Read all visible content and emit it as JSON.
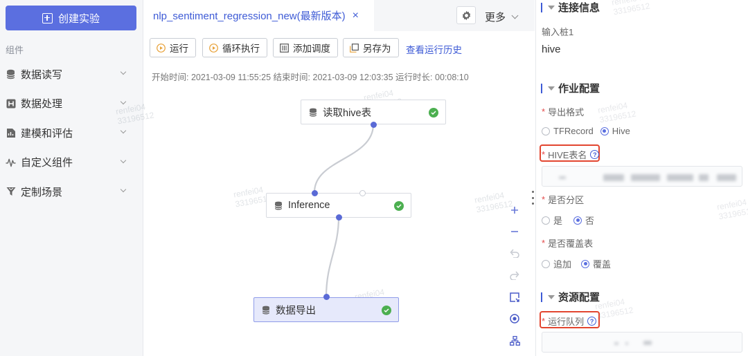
{
  "sidebar": {
    "create_button": "创建实验",
    "group_label": "组件",
    "items": [
      {
        "label": "数据读写",
        "icon": "database-icon"
      },
      {
        "label": "数据处理",
        "icon": "data-processing-icon"
      },
      {
        "label": "建模和评估",
        "icon": "model-icon"
      },
      {
        "label": "自定义组件",
        "icon": "custom-wave-icon"
      },
      {
        "label": "定制场景",
        "icon": "filter-icon"
      }
    ]
  },
  "tab": {
    "title": "nlp_sentiment_regression_new(最新版本)",
    "close": "×"
  },
  "header": {
    "more_label": "更多"
  },
  "toolbar": {
    "run": "运行",
    "loop_run": "循环执行",
    "add_schedule": "添加调度",
    "save_as": "另存为",
    "history_link": "查看运行历史"
  },
  "run_info": "开始时间: 2021-03-09 11:55:25  结束时间: 2021-03-09 12:03:35  运行时长: 00:08:10",
  "nodes": [
    {
      "label": "读取hive表",
      "status": "success"
    },
    {
      "label": "Inference",
      "status": "success"
    },
    {
      "label": "数据导出",
      "status": "success"
    }
  ],
  "watermark": {
    "line1": "renfei04",
    "line2": "33196512"
  },
  "right_panel": {
    "conn_section": "连接信息",
    "input_port_label": "输入桩1",
    "input_port_value": "hive",
    "job_section": "作业配置",
    "export_format_label": "导出格式",
    "export_format_options": [
      "TFRecord",
      "Hive"
    ],
    "export_format_selected": "Hive",
    "hive_table_label": "HIVE表名",
    "partition_label": "是否分区",
    "partition_options": [
      "是",
      "否"
    ],
    "partition_selected": "否",
    "overwrite_label": "是否覆盖表",
    "overwrite_options": [
      "追加",
      "覆盖"
    ],
    "overwrite_selected": "覆盖",
    "resource_section": "资源配置",
    "queue_label": "运行队列",
    "help_glyph": "?",
    "required_mark": "*"
  },
  "colors": {
    "accent": "#5b6fe0",
    "link": "#3e5bd6",
    "success": "#4caf50",
    "highlight": "#e2452f"
  }
}
